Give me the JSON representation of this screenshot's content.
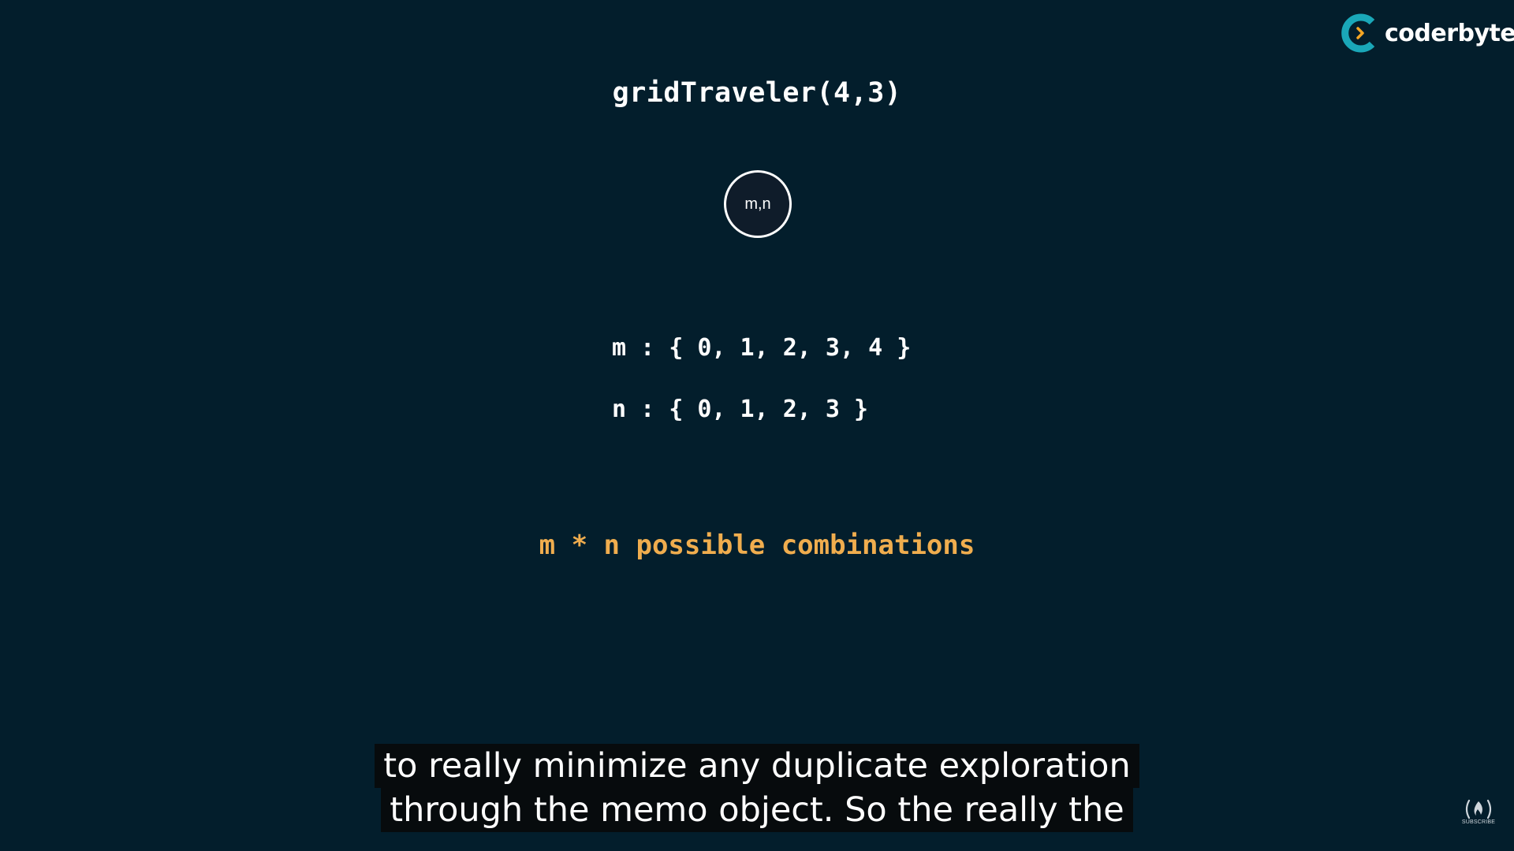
{
  "slide": {
    "title": "gridTraveler(4,3)",
    "node_label": "m,n",
    "m_set": "m : { 0, 1, 2, 3, 4 }",
    "n_set": "n : { 0, 1, 2, 3 }",
    "combinations": "m * n possible combinations"
  },
  "logo": {
    "text": "coderbyte",
    "icon": "coderbyte-logo-icon"
  },
  "captions": {
    "line1": "to really minimize any duplicate exploration",
    "line2": "through the memo object. So the really the"
  },
  "subscribe": {
    "label": "SUBSCRIBE",
    "icon": "freecodecamp-icon"
  },
  "colors": {
    "background": "#031e2c",
    "highlight": "#f0ad4e",
    "logo_teal": "#1aa7b8",
    "logo_orange": "#f5a623"
  }
}
